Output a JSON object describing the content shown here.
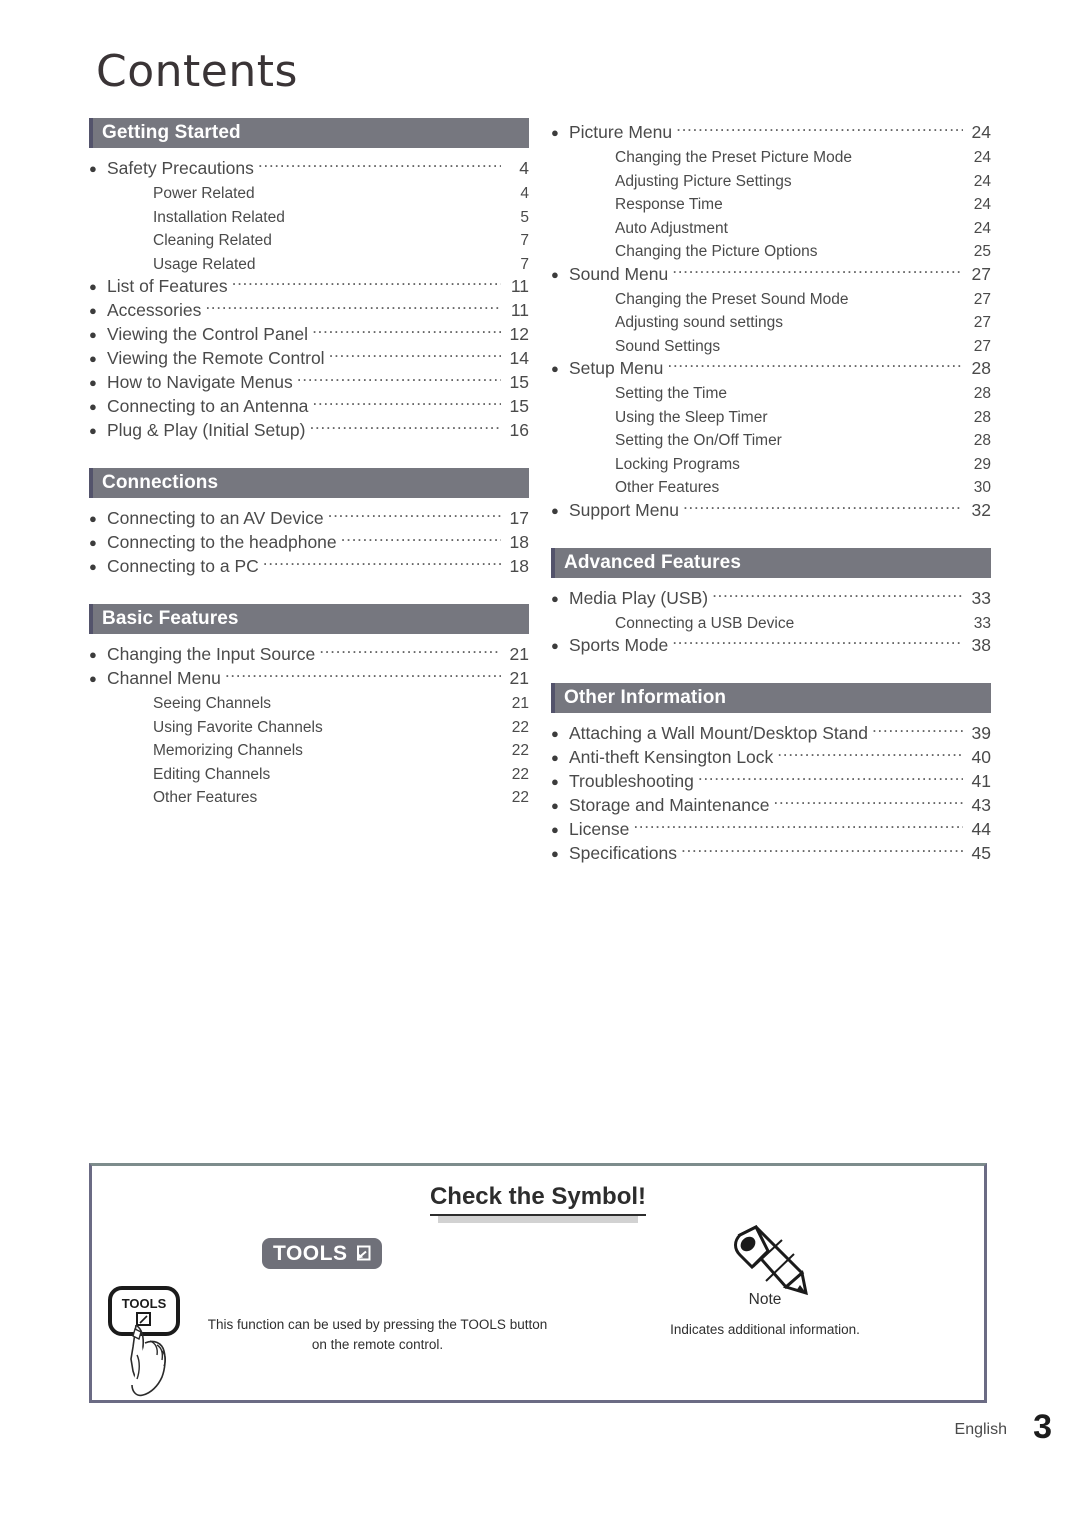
{
  "document": {
    "title": "Contents"
  },
  "columns": {
    "left": [
      {
        "heading": "Getting Started",
        "entries": [
          {
            "level": "main",
            "label": "Safety Precautions",
            "page": "4"
          },
          {
            "level": "sub",
            "label": "Power Related",
            "page": "4"
          },
          {
            "level": "sub",
            "label": "Installation Related",
            "page": "5"
          },
          {
            "level": "sub",
            "label": "Cleaning Related",
            "page": "7"
          },
          {
            "level": "sub",
            "label": "Usage Related",
            "page": "7"
          },
          {
            "level": "main",
            "label": "List of Features",
            "page": "11"
          },
          {
            "level": "main",
            "label": "Accessories",
            "page": "11"
          },
          {
            "level": "main",
            "label": "Viewing the Control Panel",
            "page": "12"
          },
          {
            "level": "main",
            "label": "Viewing the Remote Control",
            "page": "14"
          },
          {
            "level": "main",
            "label": "How to Navigate Menus",
            "page": "15"
          },
          {
            "level": "main",
            "label": "Connecting to an Antenna",
            "page": "15"
          },
          {
            "level": "main",
            "label": "Plug & Play (Initial Setup)",
            "page": "16"
          }
        ]
      },
      {
        "heading": "Connections",
        "entries": [
          {
            "level": "main",
            "label": "Connecting to an AV Device",
            "page": "17"
          },
          {
            "level": "main",
            "label": "Connecting to the headphone",
            "page": "18"
          },
          {
            "level": "main",
            "label": "Connecting to a PC",
            "page": "18"
          }
        ]
      },
      {
        "heading": "Basic Features",
        "entries": [
          {
            "level": "main",
            "label": "Changing the Input Source",
            "page": "21"
          },
          {
            "level": "main",
            "label": "Channel Menu",
            "page": "21"
          },
          {
            "level": "sub",
            "label": "Seeing Channels",
            "page": "21"
          },
          {
            "level": "sub",
            "label": "Using Favorite Channels",
            "page": "22"
          },
          {
            "level": "sub",
            "label": "Memorizing Channels",
            "page": "22"
          },
          {
            "level": "sub",
            "label": "Editing Channels",
            "page": "22"
          },
          {
            "level": "sub",
            "label": "Other Features",
            "page": "22"
          }
        ]
      }
    ],
    "right": [
      {
        "heading": null,
        "entries": [
          {
            "level": "main",
            "label": "Picture Menu",
            "page": "24"
          },
          {
            "level": "sub",
            "label": "Changing the Preset Picture Mode",
            "page": "24"
          },
          {
            "level": "sub",
            "label": "Adjusting Picture Settings",
            "page": "24"
          },
          {
            "level": "sub",
            "label": "Response Time",
            "page": "24"
          },
          {
            "level": "sub",
            "label": "Auto Adjustment",
            "page": "24"
          },
          {
            "level": "sub",
            "label": "Changing the Picture Options",
            "page": "25"
          },
          {
            "level": "main",
            "label": "Sound Menu",
            "page": "27"
          },
          {
            "level": "sub",
            "label": "Changing the Preset Sound Mode",
            "page": "27"
          },
          {
            "level": "sub",
            "label": "Adjusting sound settings",
            "page": "27"
          },
          {
            "level": "sub",
            "label": "Sound Settings",
            "page": "27"
          },
          {
            "level": "main",
            "label": "Setup Menu",
            "page": "28"
          },
          {
            "level": "sub",
            "label": "Setting the Time",
            "page": "28"
          },
          {
            "level": "sub",
            "label": "Using the Sleep Timer",
            "page": "28"
          },
          {
            "level": "sub",
            "label": "Setting the On/Off Timer",
            "page": "28"
          },
          {
            "level": "sub",
            "label": "Locking Programs",
            "page": "29"
          },
          {
            "level": "sub",
            "label": "Other Features",
            "page": "30"
          },
          {
            "level": "main",
            "label": "Support Menu",
            "page": "32"
          }
        ]
      },
      {
        "heading": "Advanced Features",
        "entries": [
          {
            "level": "main",
            "label": "Media Play (USB)",
            "page": "33"
          },
          {
            "level": "sub",
            "label": "Connecting a USB Device",
            "page": "33"
          },
          {
            "level": "main",
            "label": "Sports Mode",
            "page": "38"
          }
        ]
      },
      {
        "heading": "Other Information",
        "entries": [
          {
            "level": "main",
            "label": "Attaching a Wall Mount/Desktop Stand",
            "page": "39"
          },
          {
            "level": "main",
            "label": "Anti-theft Kensington Lock",
            "page": "40"
          },
          {
            "level": "main",
            "label": "Troubleshooting",
            "page": "41"
          },
          {
            "level": "main",
            "label": "Storage and Maintenance",
            "page": "43"
          },
          {
            "level": "main",
            "label": "License",
            "page": "44"
          },
          {
            "level": "main",
            "label": "Specifications",
            "page": "45"
          }
        ]
      }
    ]
  },
  "symbol_box": {
    "heading": "Check the Symbol!",
    "tools": {
      "badge_label": "TOOLS",
      "badge_icon": "tools-enter-icon",
      "remote_button_label": "TOOLS",
      "remote_art": "hand-pressing-tools-button",
      "caption": "This function can be used by pressing the TOOLS button on the remote control."
    },
    "note": {
      "icon": "pencil-icon",
      "label": "Note",
      "caption": "Indicates additional information."
    }
  },
  "footer": {
    "language": "English",
    "page_number": "3"
  },
  "colors": {
    "section_bar": "#76777f",
    "section_bar_edge": "#53536b",
    "box_border": "#6b6b84",
    "box_border_top": "#7d8c8c",
    "text": "#4a4a4a",
    "title": "#3a3436",
    "underbar": "#d2d2d2",
    "pill": "#6f7079"
  }
}
